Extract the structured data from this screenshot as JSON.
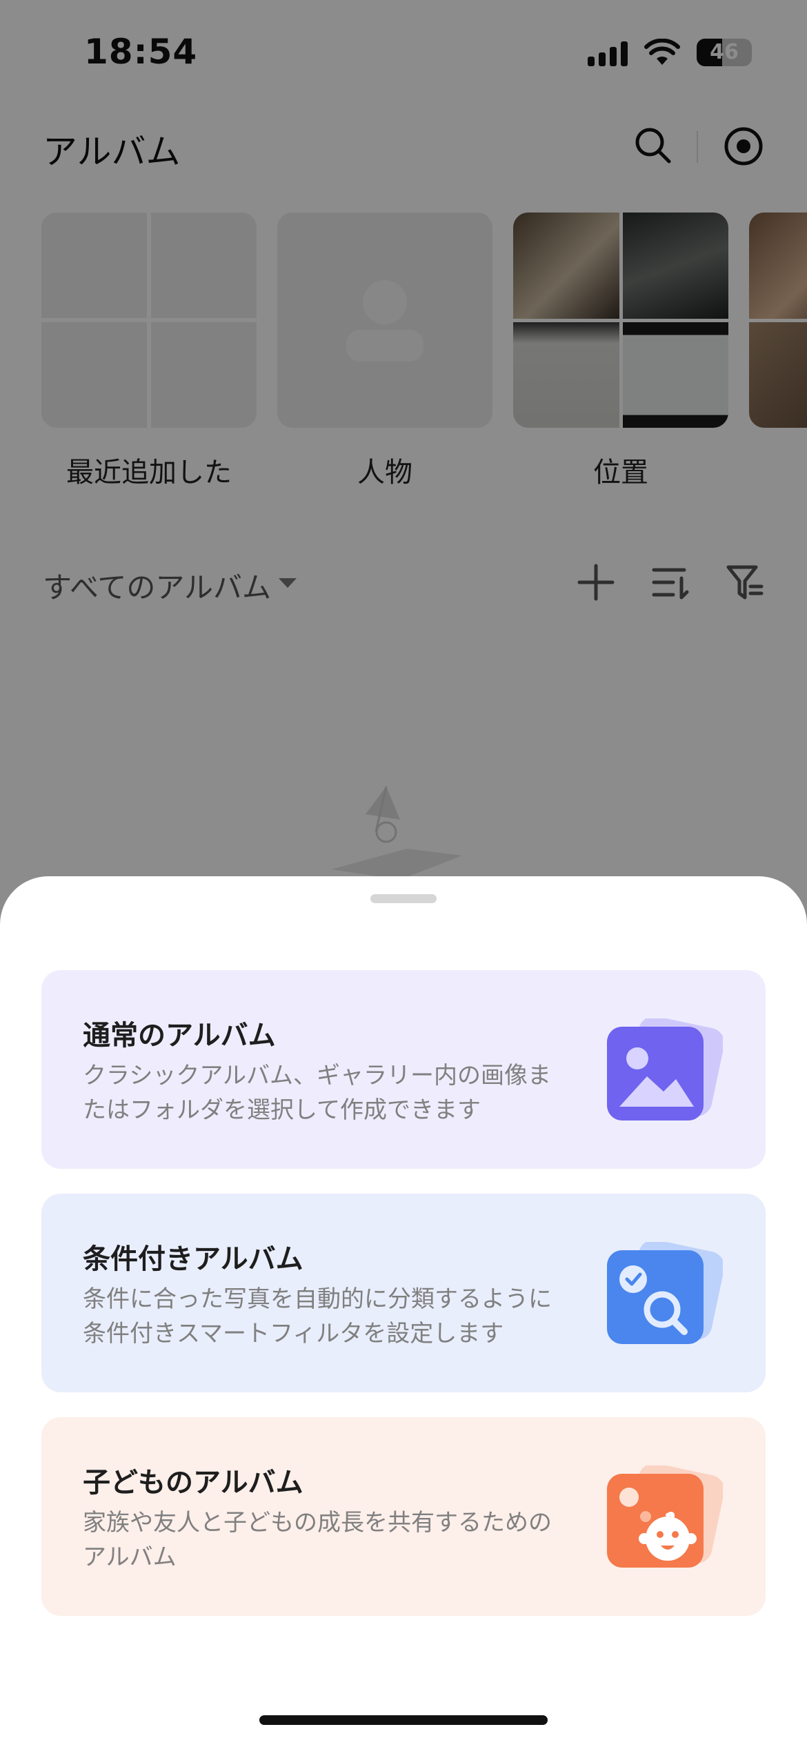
{
  "status_bar": {
    "time": "18:54",
    "battery_level": "46",
    "battery_fraction": 0.46,
    "icons": [
      "signal-icon",
      "wifi-icon",
      "battery-icon"
    ]
  },
  "header": {
    "title": "アルバム",
    "icons": [
      "search-icon",
      "target-icon"
    ]
  },
  "quick_albums": [
    {
      "label": "最近追加した",
      "icon": "grid-placeholder"
    },
    {
      "label": "人物",
      "icon": "person-placeholder"
    },
    {
      "label": "位置",
      "icon": "photo-collage"
    }
  ],
  "all_albums": {
    "label": "すべてのアルバム",
    "icons": [
      "plus-icon",
      "sort-icon",
      "filter-icon"
    ]
  },
  "sheet": {
    "options": [
      {
        "title": "通常のアルバム",
        "description": "クラシックアルバム、ギャラリー内の画像ま\nたはフォルダを選択して作成できます",
        "icon": "image-album-icon",
        "color": "#6f63ef"
      },
      {
        "title": "条件付きアルバム",
        "description": "条件に合った写真を自動的に分類するように\n条件付きスマートフィルタを設定します",
        "icon": "smart-filter-icon",
        "color": "#4a86ee"
      },
      {
        "title": "子どものアルバム",
        "description": "家族や友人と子どもの成長を共有するための\nアルバム",
        "icon": "child-album-icon",
        "color": "#f5794a"
      }
    ]
  }
}
